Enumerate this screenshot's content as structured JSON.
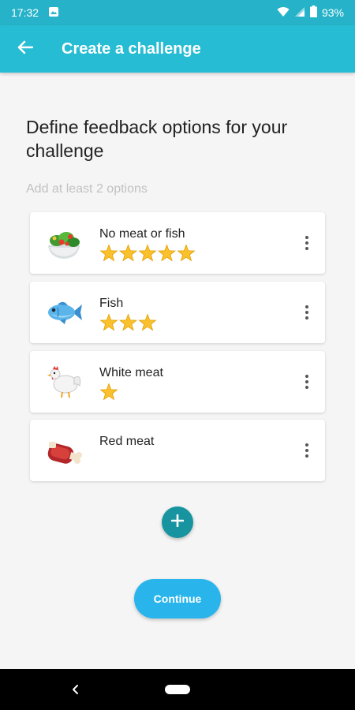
{
  "status_bar": {
    "time": "17:32",
    "battery": "93%"
  },
  "app_bar": {
    "title": "Create a challenge"
  },
  "heading": "Define feedback options for your challenge",
  "hint": "Add at least 2 options",
  "options": [
    {
      "label": "No meat or fish",
      "icon": "salad-icon",
      "stars": 5
    },
    {
      "label": "Fish",
      "icon": "fish-icon",
      "stars": 3
    },
    {
      "label": "White meat",
      "icon": "chicken-icon",
      "stars": 1
    },
    {
      "label": "Red meat",
      "icon": "meat-icon",
      "stars": 0
    }
  ],
  "continue_label": "Continue",
  "colors": {
    "app_bar": "#26bcd4",
    "status_bar": "#26b3c9",
    "add_button": "#17949f",
    "continue_button": "#29b5ec",
    "star": "#fbc02d"
  }
}
